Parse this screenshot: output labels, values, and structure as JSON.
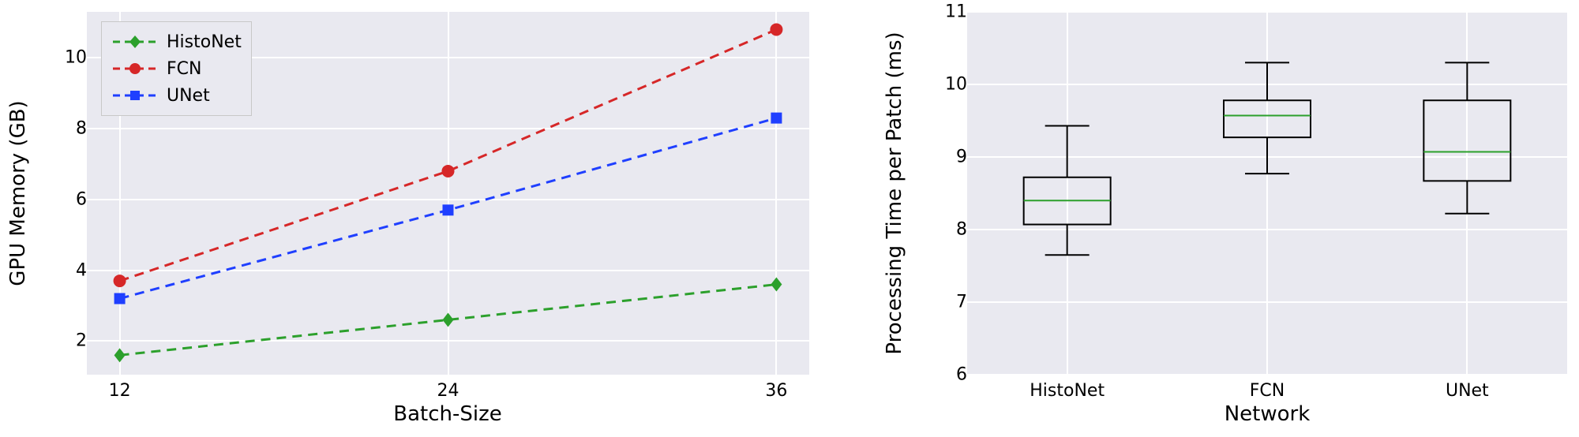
{
  "chart_data": [
    {
      "type": "line",
      "xlabel": "Batch-Size",
      "ylabel": "GPU Memory (GB)",
      "x": [
        12,
        24,
        36
      ],
      "xticks": [
        12,
        24,
        36
      ],
      "yticks": [
        2,
        4,
        6,
        8,
        10
      ],
      "xlim": [
        10.8,
        37.2
      ],
      "ylim": [
        1.05,
        11.3
      ],
      "grid": true,
      "series": [
        {
          "name": "HistoNet",
          "color": "#2ca02c",
          "marker": "diamond",
          "values": [
            1.6,
            2.6,
            3.6
          ]
        },
        {
          "name": "FCN",
          "color": "#d62728",
          "marker": "circle",
          "values": [
            3.7,
            6.8,
            10.8
          ]
        },
        {
          "name": "UNet",
          "color": "#1f3fff",
          "marker": "square",
          "values": [
            3.2,
            5.7,
            8.3
          ]
        }
      ],
      "legend_position": "upper-left"
    },
    {
      "type": "boxplot",
      "xlabel": "Network",
      "ylabel": "Processing Time per Patch (ms)",
      "ylim": [
        6,
        11
      ],
      "yticks": [
        6,
        7,
        8,
        9,
        10,
        11
      ],
      "categories": [
        "HistoNet",
        "FCN",
        "UNet"
      ],
      "boxes": [
        {
          "name": "HistoNet",
          "whisker_low": 7.65,
          "q1": 8.07,
          "median": 8.4,
          "q3": 8.72,
          "whisker_high": 9.43
        },
        {
          "name": "FCN",
          "whisker_low": 8.77,
          "q1": 9.27,
          "median": 9.57,
          "q3": 9.78,
          "whisker_high": 10.3
        },
        {
          "name": "UNet",
          "whisker_low": 8.22,
          "q1": 8.67,
          "median": 9.07,
          "q3": 9.78,
          "whisker_high": 10.3
        }
      ]
    }
  ],
  "left": {
    "xlabel": "Batch-Size",
    "ylabel": "GPU Memory (GB)",
    "xticks": [
      "12",
      "24",
      "36"
    ],
    "yticks": [
      "2",
      "4",
      "6",
      "8",
      "10"
    ],
    "legend": {
      "s0": "HistoNet",
      "s1": "FCN",
      "s2": "UNet"
    }
  },
  "right": {
    "xlabel": "Network",
    "ylabel": "Processing Time per Patch (ms)",
    "xticks": [
      "HistoNet",
      "FCN",
      "UNet"
    ],
    "yticks": [
      "6",
      "7",
      "8",
      "9",
      "10",
      "11"
    ]
  }
}
